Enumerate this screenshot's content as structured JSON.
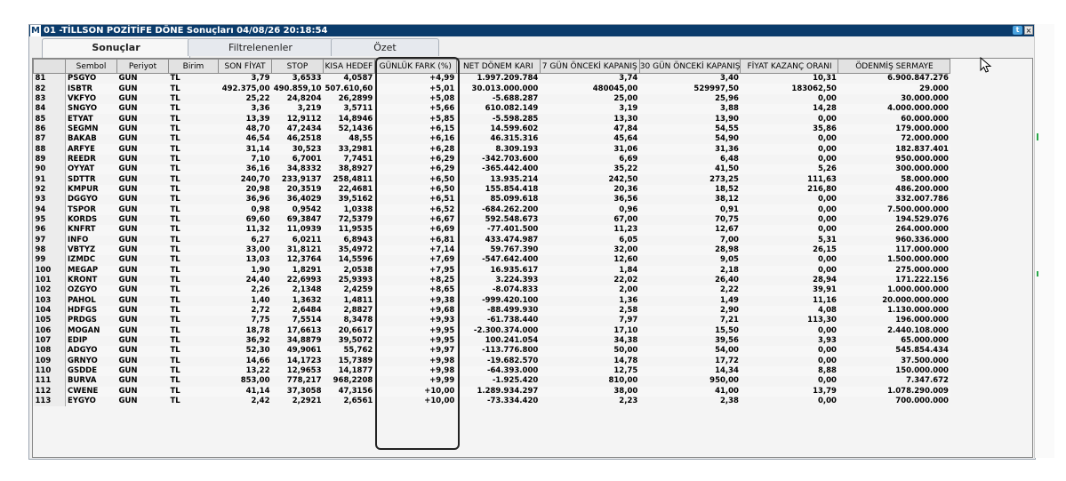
{
  "window": {
    "app_icon": "M",
    "title": "01 -TİLLSON POZİTİFE DÖNE Sonuçları  04/08/26 20:18:54",
    "twitter_icon": "twitter-icon",
    "close_icon": "close-icon"
  },
  "tabs": [
    {
      "label": "Sonuçlar",
      "active": true
    },
    {
      "label": "Filtrelenenler",
      "active": false
    },
    {
      "label": "Özet",
      "active": false
    }
  ],
  "columns": [
    "",
    "Sembol",
    "Periyot",
    "Birim",
    "SON FİYAT",
    "STOP",
    "KISA HEDEF",
    "GÜNLÜK FARK (%)",
    "NET DÖNEM KARI",
    "7 GÜN ÖNCEKİ KAPANIŞ",
    "30 GÜN ÖNCEKİ KAPANIŞ",
    "FİYAT KAZANÇ ORANI",
    "ÖDENMİŞ SERMAYE"
  ],
  "rows": [
    [
      "81",
      "PSGYO",
      "GUN",
      "TL",
      "3,79",
      "3,6533",
      "4,0587",
      "+4,99",
      "1.997.209.784",
      "3,74",
      "3,40",
      "10,31",
      "6.900.847.276"
    ],
    [
      "82",
      "ISBTR",
      "GUN",
      "TL",
      "492.375,00",
      "490.859,10",
      "507.610,60",
      "+5,01",
      "30.013.000.000",
      "480045,00",
      "529997,50",
      "183062,50",
      "29.000"
    ],
    [
      "83",
      "VKFYO",
      "GUN",
      "TL",
      "25,22",
      "24,8204",
      "26,2899",
      "+5,08",
      "-5.688.287",
      "25,00",
      "25,96",
      "0,00",
      "30.000.000"
    ],
    [
      "84",
      "SNGYO",
      "GUN",
      "TL",
      "3,36",
      "3,219",
      "3,5711",
      "+5,66",
      "610.082.149",
      "3,19",
      "3,88",
      "14,28",
      "4.000.000.000"
    ],
    [
      "85",
      "ETYAT",
      "GUN",
      "TL",
      "13,39",
      "12,9112",
      "14,8946",
      "+5,85",
      "-5.598.285",
      "13,30",
      "13,90",
      "0,00",
      "60.000.000"
    ],
    [
      "86",
      "SEGMN",
      "GUN",
      "TL",
      "48,70",
      "47,2434",
      "52,1436",
      "+6,15",
      "14.599.602",
      "47,84",
      "54,55",
      "35,86",
      "179.000.000"
    ],
    [
      "87",
      "BAKAB",
      "GUN",
      "TL",
      "46,54",
      "46,2518",
      "48,55",
      "+6,16",
      "46.315.316",
      "45,64",
      "54,90",
      "0,00",
      "72.000.000"
    ],
    [
      "88",
      "ARFYE",
      "GUN",
      "TL",
      "31,14",
      "30,523",
      "33,2981",
      "+6,28",
      "8.309.193",
      "31,06",
      "31,36",
      "0,00",
      "182.837.401"
    ],
    [
      "89",
      "REEDR",
      "GUN",
      "TL",
      "7,10",
      "6,7001",
      "7,7451",
      "+6,29",
      "-342.703.600",
      "6,69",
      "6,48",
      "0,00",
      "950.000.000"
    ],
    [
      "90",
      "OYYAT",
      "GUN",
      "TL",
      "36,16",
      "34,8332",
      "38,8927",
      "+6,29",
      "-365.442.400",
      "35,22",
      "41,50",
      "5,26",
      "300.000.000"
    ],
    [
      "91",
      "SDTTR",
      "GUN",
      "TL",
      "240,70",
      "233,9137",
      "258,4811",
      "+6,50",
      "13.935.214",
      "242,50",
      "273,25",
      "111,63",
      "58.000.000"
    ],
    [
      "92",
      "KMPUR",
      "GUN",
      "TL",
      "20,98",
      "20,3519",
      "22,4681",
      "+6,50",
      "155.854.418",
      "20,36",
      "18,52",
      "216,80",
      "486.200.000"
    ],
    [
      "93",
      "DGGYO",
      "GUN",
      "TL",
      "36,96",
      "36,4029",
      "39,5162",
      "+6,51",
      "85.099.618",
      "36,56",
      "38,12",
      "0,00",
      "332.007.786"
    ],
    [
      "94",
      "TSPOR",
      "GUN",
      "TL",
      "0,98",
      "0,9542",
      "1,0338",
      "+6,52",
      "-684.262.200",
      "0,96",
      "0,91",
      "0,00",
      "7.500.000.000"
    ],
    [
      "95",
      "KORDS",
      "GUN",
      "TL",
      "69,60",
      "69,3847",
      "72,5379",
      "+6,67",
      "592.548.673",
      "67,00",
      "70,75",
      "0,00",
      "194.529.076"
    ],
    [
      "96",
      "KNFRT",
      "GUN",
      "TL",
      "11,32",
      "11,0939",
      "11,9535",
      "+6,69",
      "-77.401.500",
      "11,23",
      "12,67",
      "0,00",
      "264.000.000"
    ],
    [
      "97",
      "INFO",
      "GUN",
      "TL",
      "6,27",
      "6,0211",
      "6,8943",
      "+6,81",
      "433.474.987",
      "6,05",
      "7,00",
      "5,31",
      "960.336.000"
    ],
    [
      "98",
      "VBTYZ",
      "GUN",
      "TL",
      "33,00",
      "31,8121",
      "35,4972",
      "+7,14",
      "59.767.390",
      "32,00",
      "28,98",
      "26,15",
      "117.000.000"
    ],
    [
      "99",
      "IZMDC",
      "GUN",
      "TL",
      "13,03",
      "12,3764",
      "14,5596",
      "+7,69",
      "-547.642.400",
      "12,60",
      "9,05",
      "0,00",
      "1.500.000.000"
    ],
    [
      "100",
      "MEGAP",
      "GUN",
      "TL",
      "1,90",
      "1,8291",
      "2,0538",
      "+7,95",
      "16.935.617",
      "1,84",
      "2,18",
      "0,00",
      "275.000.000"
    ],
    [
      "101",
      "KRONT",
      "GUN",
      "TL",
      "24,40",
      "22,6993",
      "25,9393",
      "+8,25",
      "3.224.393",
      "22,02",
      "26,40",
      "28,94",
      "171.222.156"
    ],
    [
      "102",
      "OZGYO",
      "GUN",
      "TL",
      "2,26",
      "2,1348",
      "2,4259",
      "+8,65",
      "-8.074.833",
      "2,00",
      "2,22",
      "39,91",
      "1.000.000.000"
    ],
    [
      "103",
      "PAHOL",
      "GUN",
      "TL",
      "1,40",
      "1,3632",
      "1,4811",
      "+9,38",
      "-999.420.100",
      "1,36",
      "1,49",
      "11,16",
      "20.000.000.000"
    ],
    [
      "104",
      "HDFGS",
      "GUN",
      "TL",
      "2,72",
      "2,6484",
      "2,8827",
      "+9,68",
      "-88.499.930",
      "2,58",
      "2,90",
      "4,08",
      "1.130.000.000"
    ],
    [
      "105",
      "PRDGS",
      "GUN",
      "TL",
      "7,75",
      "7,5514",
      "8,3478",
      "+9,93",
      "-61.738.440",
      "7,97",
      "7,21",
      "113,30",
      "196.000.000"
    ],
    [
      "106",
      "MOGAN",
      "GUN",
      "TL",
      "18,78",
      "17,6613",
      "20,6617",
      "+9,95",
      "-2.300.374.000",
      "17,10",
      "15,50",
      "0,00",
      "2.440.108.000"
    ],
    [
      "107",
      "EDIP",
      "GUN",
      "TL",
      "36,92",
      "34,8879",
      "39,5072",
      "+9,95",
      "100.241.054",
      "34,38",
      "39,56",
      "3,93",
      "65.000.000"
    ],
    [
      "108",
      "ADGYO",
      "GUN",
      "TL",
      "52,30",
      "49,9061",
      "55,762",
      "+9,97",
      "-113.776.800",
      "50,00",
      "54,00",
      "0,00",
      "545.854.434"
    ],
    [
      "109",
      "GRNYO",
      "GUN",
      "TL",
      "14,66",
      "14,1723",
      "15,7389",
      "+9,98",
      "-19.682.570",
      "14,78",
      "17,72",
      "0,00",
      "37.500.000"
    ],
    [
      "110",
      "GSDDE",
      "GUN",
      "TL",
      "13,22",
      "12,9653",
      "14,1877",
      "+9,98",
      "-64.393.000",
      "12,75",
      "14,34",
      "8,88",
      "150.000.000"
    ],
    [
      "111",
      "BURVA",
      "GUN",
      "TL",
      "853,00",
      "778,217",
      "968,2208",
      "+9,99",
      "-1.925.420",
      "810,00",
      "950,00",
      "0,00",
      "7.347.672"
    ],
    [
      "112",
      "CWENE",
      "GUN",
      "TL",
      "41,14",
      "37,3058",
      "47,3156",
      "+10,00",
      "1.289.934.297",
      "38,00",
      "41,00",
      "13,79",
      "1.078.290.009"
    ],
    [
      "113",
      "EYGYO",
      "GUN",
      "TL",
      "2,42",
      "2,2921",
      "2,6561",
      "+10,00",
      "-73.334.420",
      "2,23",
      "2,38",
      "0,00",
      "700.000.000"
    ]
  ]
}
